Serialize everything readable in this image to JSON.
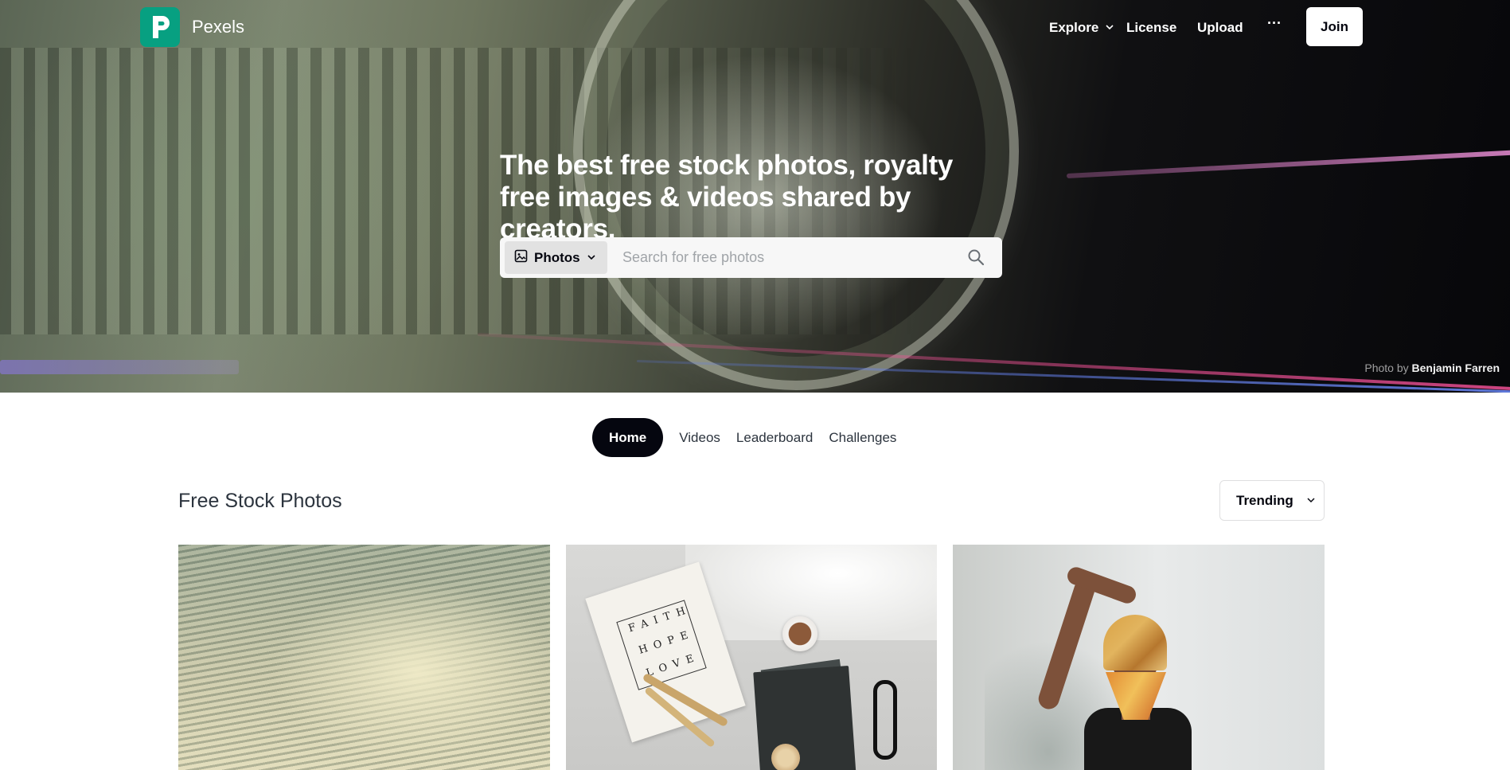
{
  "nav": {
    "brand": "Pexels",
    "explore": "Explore",
    "license": "License",
    "upload": "Upload",
    "more": "···",
    "join": "Join"
  },
  "hero": {
    "headline": "The best free stock photos, royalty free images & videos shared by creators.",
    "search": {
      "type_label": "Photos",
      "placeholder": "Search for free photos"
    },
    "credit_prefix": "Photo by",
    "credit_name": "Benjamin Farren"
  },
  "tabs": [
    {
      "label": "Home",
      "active": true
    },
    {
      "label": "Videos",
      "active": false
    },
    {
      "label": "Leaderboard",
      "active": false
    },
    {
      "label": "Challenges",
      "active": false
    }
  ],
  "section": {
    "title": "Free Stock Photos",
    "sort_label": "Trending"
  },
  "photo_text": {
    "card_words": [
      "FAITH",
      "HOPE",
      "LOVE"
    ]
  },
  "colors": {
    "brand": "#07a081",
    "tab_active_bg": "#05060f",
    "text": "#2c343e"
  },
  "icons": {
    "logo": "pexels-logo-icon",
    "explore_chevron": "chevron-down-icon",
    "more": "more-dots-icon",
    "search_type": "image-icon",
    "search_type_chevron": "chevron-down-icon",
    "search": "search-icon",
    "sort_chevron": "chevron-down-icon"
  }
}
